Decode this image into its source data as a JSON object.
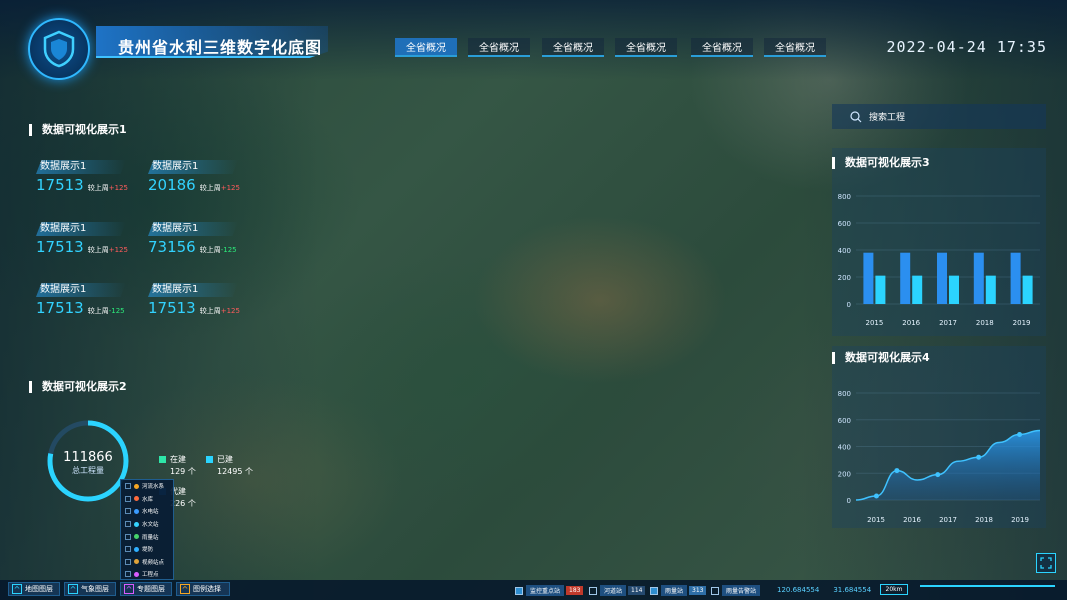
{
  "app": {
    "title": "贵州省水利三维数字化底图",
    "datetime": "2022-04-24 17:35"
  },
  "tabs": [
    {
      "label": "全省概况"
    },
    {
      "label": "全省概况"
    },
    {
      "label": "全省概况"
    },
    {
      "label": "全省概况"
    },
    {
      "label": "全省概况"
    },
    {
      "label": "全省概况"
    }
  ],
  "left": {
    "section1_title": "数据可视化展示1",
    "stats": [
      {
        "label": "数据展示1",
        "value": "17513",
        "compare": "较上周",
        "delta": "+125",
        "trend": "up"
      },
      {
        "label": "数据展示1",
        "value": "20186",
        "compare": "较上周",
        "delta": "+125",
        "trend": "up"
      },
      {
        "label": "数据展示1",
        "value": "17513",
        "compare": "较上周",
        "delta": "+125",
        "trend": "up"
      },
      {
        "label": "数据展示1",
        "value": "73156",
        "compare": "较上周",
        "delta": "-125",
        "trend": "down"
      },
      {
        "label": "数据展示1",
        "value": "17513",
        "compare": "较上周",
        "delta": "-125",
        "trend": "down"
      },
      {
        "label": "数据展示1",
        "value": "17513",
        "compare": "较上周",
        "delta": "+125",
        "trend": "up"
      }
    ],
    "section2_title": "数据可视化展示2",
    "donut": {
      "value": "111866",
      "label": "总工程量",
      "fraction": 0.78
    },
    "legend": [
      {
        "label": "在建",
        "count": "129 个",
        "color": "#2ee6a8"
      },
      {
        "label": "已建",
        "count": "12495 个",
        "color": "#2bd4ff"
      },
      {
        "label": "代建",
        "count": "226 个",
        "color": "#1f7fd8"
      }
    ],
    "layers": [
      {
        "label": "河流水系",
        "color": "#f5a623"
      },
      {
        "label": "水库",
        "color": "#ff6b3d"
      },
      {
        "label": "水电站",
        "color": "#3b9bff"
      },
      {
        "label": "水文站",
        "color": "#35d3ff"
      },
      {
        "label": "雨量站",
        "color": "#46d36b"
      },
      {
        "label": "堤防",
        "color": "#2fb0ff"
      },
      {
        "label": "视频站点",
        "color": "#e0a33a"
      },
      {
        "label": "工程点",
        "color": "#d85cff"
      }
    ]
  },
  "right": {
    "search_placeholder": "搜索工程",
    "section3_title": "数据可视化展示3",
    "section4_title": "数据可视化展示4"
  },
  "chart_data": [
    {
      "type": "bar",
      "categories": [
        "2015",
        "2016",
        "2017",
        "2018",
        "2019"
      ],
      "series": [
        {
          "values": [
            380,
            380,
            380,
            380,
            380
          ],
          "color": "#2b8ff0"
        },
        {
          "values": [
            210,
            210,
            210,
            210,
            210
          ],
          "color": "#2bd4ff"
        }
      ],
      "yticks": [
        "0",
        "200",
        "400",
        "600",
        "800"
      ],
      "ylim": [
        0,
        800
      ],
      "grid": true
    },
    {
      "type": "area",
      "categories": [
        "2015",
        "2016",
        "2017",
        "2018",
        "2019"
      ],
      "x": [
        0,
        0.5,
        1,
        1.5,
        2,
        2.5,
        3,
        3.5,
        4,
        4.5
      ],
      "values": [
        0,
        30,
        220,
        150,
        190,
        290,
        320,
        430,
        490,
        520
      ],
      "markers": [
        1,
        2,
        4,
        6,
        8
      ],
      "yticks": [
        "0",
        "200",
        "400",
        "600",
        "800"
      ],
      "ylim": [
        0,
        800
      ],
      "grid": true
    }
  ],
  "bottom": {
    "buttons": [
      {
        "label": "地图图层",
        "icon": "^"
      },
      {
        "label": "气象图层",
        "icon": "^"
      },
      {
        "label": "专题图层",
        "icon": "^"
      },
      {
        "label": "图例选择",
        "icon": "^"
      }
    ],
    "stations": [
      {
        "label": "监控重点站",
        "count": "183",
        "checked": true,
        "count_color": "#c0392b"
      },
      {
        "label": "河道站",
        "count": "114",
        "checked": false,
        "count_color": "#254a70"
      },
      {
        "label": "雨量站",
        "count": "313",
        "checked": true,
        "count_color": "#2e6fa8"
      },
      {
        "label": "雨量告警站",
        "count": "",
        "checked": false,
        "count_color": "#254a70"
      }
    ],
    "coords": [
      "120.684554",
      "31.684554"
    ],
    "scale": "20km"
  }
}
